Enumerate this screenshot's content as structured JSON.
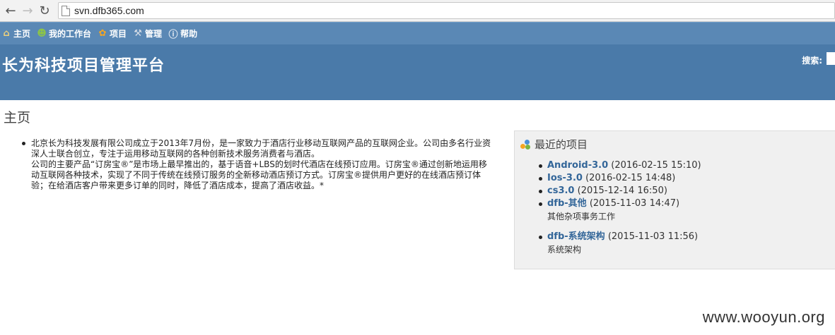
{
  "browser": {
    "url": "svn.dfb365.com",
    "back_icon": "arrow-left",
    "forward_icon": "arrow-right",
    "reload_icon": "reload"
  },
  "menu": [
    {
      "label": "主页",
      "icon": "home-icon"
    },
    {
      "label": "我的工作台",
      "icon": "user-icon"
    },
    {
      "label": "项目",
      "icon": "projects-icon"
    },
    {
      "label": "管理",
      "icon": "wrench-icon"
    },
    {
      "label": "帮助",
      "icon": "help-icon"
    }
  ],
  "header": {
    "site_title": "长为科技项目管理平台",
    "search_label": "搜索:"
  },
  "page": {
    "title": "主页",
    "intro": "北京长为科技发展有限公司成立于2013年7月份，是一家致力于酒店行业移动互联网产品的互联网企业。公司由多名行业资深人士联合创立，专注于运用移动互联网的各种创新技术服务消费者与酒店。\n公司的主要产品“订房宝®”是市场上最早推出的，基于语音+LBS的划时代酒店在线预订应用。订房宝®通过创新地运用移动互联网各种技术，实现了不同于传统在线预订服务的全新移动酒店预订方式。订房宝®提供用户更好的在线酒店预订体验；在给酒店客户带来更多订单的同时，降低了酒店成本，提高了酒店收益。*"
  },
  "recent": {
    "title": "最近的项目",
    "projects": [
      {
        "name": "Android-3.0",
        "date": "(2016-02-15 15:10)",
        "desc": ""
      },
      {
        "name": "Ios-3.0",
        "date": "(2016-02-15 14:48)",
        "desc": ""
      },
      {
        "name": "cs3.0",
        "date": "(2015-12-14 16:50)",
        "desc": ""
      },
      {
        "name": "dfb-其他",
        "date": "(2015-11-03 14:47)",
        "desc": "其他杂项事务工作"
      },
      {
        "name": "dfb-系统架构",
        "date": "(2015-11-03 11:56)",
        "desc": "系统架构"
      }
    ]
  },
  "watermark": "www.wooyun.org",
  "colors": {
    "menubar": "#5a88b5",
    "header": "#4a7aa9",
    "link": "#336699",
    "panel_bg": "#f0f0f0"
  }
}
